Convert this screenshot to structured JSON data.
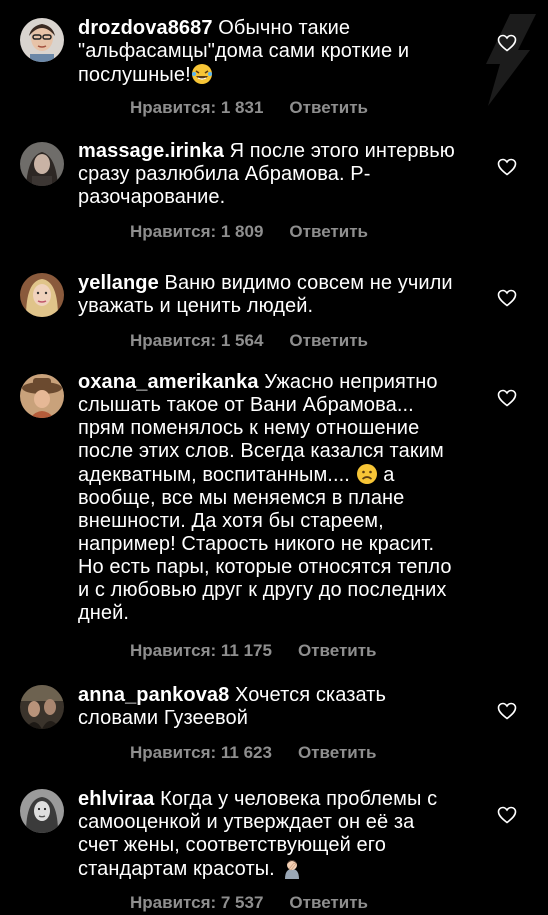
{
  "colors": {
    "background": "#000000",
    "text": "#ffffff",
    "meta": "#8e8e8e"
  },
  "comments": [
    {
      "username": "drozdova8687",
      "text": " Обычно такие \"альфасамцы\"дома сами кроткие и послушные!",
      "emoji": "laughing-tears-icon",
      "likes": "Нравится: 1 831",
      "reply": "Ответить"
    },
    {
      "username": "massage.irinka",
      "text": " Я после этого интервью сразу разлюбила Абрамова. Р-разочарование.",
      "likes": "Нравится: 1 809",
      "reply": "Ответить"
    },
    {
      "username": "yellange",
      "text": " Ваню видимо совсем не учили уважать и ценить людей.",
      "likes": "Нравится: 1 564",
      "reply": "Ответить"
    },
    {
      "username": "oxana_amerikanka",
      "text": " Ужасно неприятно слышать такое от Вани Абрамова... прям поменялось к нему отношение после этих слов. Всегда казался таким адекватным, воспитанным....",
      "emoji": "frowning-face-icon",
      "text_after": " а вообще, все мы меняемся в плане внешности. Да хотя бы стареем, например! Старость никого не красит. Но есть пары, которые относятся тепло и с любовью друг к другу до последних дней.",
      "likes": "Нравится: 11 175",
      "reply": "Ответить"
    },
    {
      "username": "anna_pankova8",
      "text": " Хочется сказать словами Гузеевой",
      "likes": "Нравится: 11 623",
      "reply": "Ответить"
    },
    {
      "username": "ehlviraa",
      "text": " Когда у человека проблемы с самооценкой и утверждает он её за счет жены, соответствующей его стандартам красоты.",
      "emoji": "woman-facepalming-icon",
      "likes": "Нравится: 7 537",
      "reply": "Ответить"
    }
  ]
}
